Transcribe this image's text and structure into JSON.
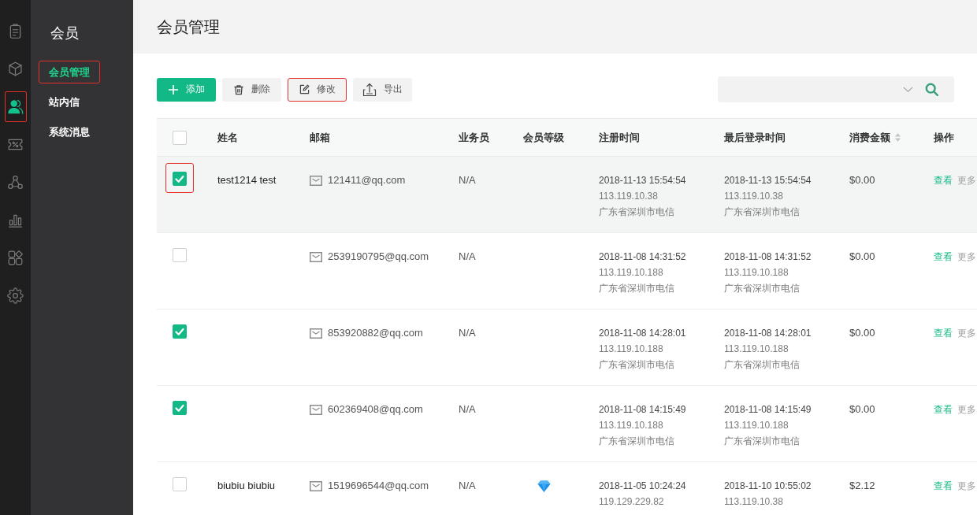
{
  "icon_rail": {
    "items": [
      {
        "selected": false,
        "highlighted": false
      },
      {
        "selected": false,
        "highlighted": false
      },
      {
        "selected": true,
        "highlighted": true
      },
      {
        "selected": false,
        "highlighted": false
      },
      {
        "selected": false,
        "highlighted": false
      },
      {
        "selected": false,
        "highlighted": false
      },
      {
        "selected": false,
        "highlighted": false
      },
      {
        "selected": false,
        "highlighted": false
      }
    ]
  },
  "sidebar": {
    "title": "会员",
    "items": [
      {
        "label": "会员管理",
        "selected": true,
        "highlighted": true
      },
      {
        "label": "站内信",
        "selected": false,
        "highlighted": false
      },
      {
        "label": "系统消息",
        "selected": false,
        "highlighted": false
      }
    ]
  },
  "page": {
    "title": "会员管理"
  },
  "toolbar": {
    "buttons": [
      {
        "label": "添加",
        "kind": "primary",
        "highlighted": false
      },
      {
        "label": "删除",
        "kind": "default",
        "highlighted": false
      },
      {
        "label": "修改",
        "kind": "default",
        "highlighted": true
      },
      {
        "label": "导出",
        "kind": "default",
        "highlighted": false
      }
    ]
  },
  "search": {
    "dropdown": true
  },
  "table": {
    "all_checked": false,
    "columns": [
      {
        "label": "姓名"
      },
      {
        "label": "邮箱"
      },
      {
        "label": "业务员"
      },
      {
        "label": "会员等级"
      },
      {
        "label": "注册时间"
      },
      {
        "label": "最后登录时间"
      },
      {
        "label": "消费金额",
        "sortable": true
      },
      {
        "label": "操作"
      }
    ],
    "rows": [
      {
        "checked": true,
        "highlighted": true,
        "hovered": true,
        "name": "test1214 test",
        "email": "121411@qq.com",
        "salesperson": "N/A",
        "level_badge": false,
        "registered": {
          "time": "2018-11-13 15:54:54",
          "ip": "113.119.10.38",
          "location": "广东省深圳市电信"
        },
        "last_login": {
          "time": "2018-11-13 15:54:54",
          "ip": "113.119.10.38",
          "location": "广东省深圳市电信"
        },
        "amount": "$0.00",
        "actions": [
          {
            "label": "查看",
            "kind": "primary"
          },
          {
            "label": "更多",
            "kind": "secondary"
          }
        ]
      },
      {
        "checked": false,
        "highlighted": false,
        "hovered": false,
        "email": "2539190795@qq.com",
        "salesperson": "N/A",
        "level_badge": false,
        "registered": {
          "time": "2018-11-08 14:31:52",
          "ip": "113.119.10.188",
          "location": "广东省深圳市电信"
        },
        "last_login": {
          "time": "2018-11-08 14:31:52",
          "ip": "113.119.10.188",
          "location": "广东省深圳市电信"
        },
        "amount": "$0.00",
        "actions": [
          {
            "label": "查看",
            "kind": "primary"
          },
          {
            "label": "更多",
            "kind": "secondary"
          }
        ]
      },
      {
        "checked": true,
        "highlighted": false,
        "hovered": false,
        "email": "853920882@qq.com",
        "salesperson": "N/A",
        "level_badge": false,
        "registered": {
          "time": "2018-11-08 14:28:01",
          "ip": "113.119.10.188",
          "location": "广东省深圳市电信"
        },
        "last_login": {
          "time": "2018-11-08 14:28:01",
          "ip": "113.119.10.188",
          "location": "广东省深圳市电信"
        },
        "amount": "$0.00",
        "actions": [
          {
            "label": "查看",
            "kind": "primary"
          },
          {
            "label": "更多",
            "kind": "secondary"
          }
        ]
      },
      {
        "checked": true,
        "highlighted": false,
        "hovered": false,
        "email": "602369408@qq.com",
        "salesperson": "N/A",
        "level_badge": false,
        "registered": {
          "time": "2018-11-08 14:15:49",
          "ip": "113.119.10.188",
          "location": "广东省深圳市电信"
        },
        "last_login": {
          "time": "2018-11-08 14:15:49",
          "ip": "113.119.10.188",
          "location": "广东省深圳市电信"
        },
        "amount": "$0.00",
        "actions": [
          {
            "label": "查看",
            "kind": "primary"
          },
          {
            "label": "更多",
            "kind": "secondary"
          }
        ]
      },
      {
        "checked": false,
        "highlighted": false,
        "hovered": false,
        "name": "biubiu biubiu",
        "email": "1519696544@qq.com",
        "salesperson": "N/A",
        "level_badge": true,
        "registered": {
          "time": "2018-11-05 10:24:24",
          "ip": "119.129.229.82"
        },
        "last_login": {
          "time": "2018-11-10 10:55:02",
          "ip": "113.119.10.38"
        },
        "amount": "$2.12",
        "actions": [
          {
            "label": "查看",
            "kind": "primary"
          },
          {
            "label": "更多",
            "kind": "secondary"
          }
        ]
      }
    ]
  }
}
